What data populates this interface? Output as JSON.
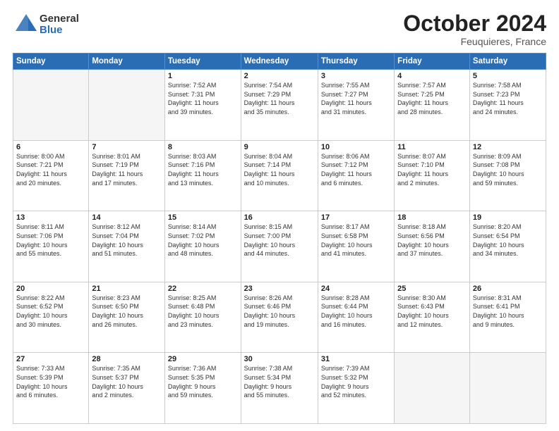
{
  "header": {
    "logo_general": "General",
    "logo_blue": "Blue",
    "month": "October 2024",
    "location": "Feuquieres, France"
  },
  "weekdays": [
    "Sunday",
    "Monday",
    "Tuesday",
    "Wednesday",
    "Thursday",
    "Friday",
    "Saturday"
  ],
  "weeks": [
    [
      {
        "day": "",
        "detail": ""
      },
      {
        "day": "",
        "detail": ""
      },
      {
        "day": "1",
        "detail": "Sunrise: 7:52 AM\nSunset: 7:31 PM\nDaylight: 11 hours\nand 39 minutes."
      },
      {
        "day": "2",
        "detail": "Sunrise: 7:54 AM\nSunset: 7:29 PM\nDaylight: 11 hours\nand 35 minutes."
      },
      {
        "day": "3",
        "detail": "Sunrise: 7:55 AM\nSunset: 7:27 PM\nDaylight: 11 hours\nand 31 minutes."
      },
      {
        "day": "4",
        "detail": "Sunrise: 7:57 AM\nSunset: 7:25 PM\nDaylight: 11 hours\nand 28 minutes."
      },
      {
        "day": "5",
        "detail": "Sunrise: 7:58 AM\nSunset: 7:23 PM\nDaylight: 11 hours\nand 24 minutes."
      }
    ],
    [
      {
        "day": "6",
        "detail": "Sunrise: 8:00 AM\nSunset: 7:21 PM\nDaylight: 11 hours\nand 20 minutes."
      },
      {
        "day": "7",
        "detail": "Sunrise: 8:01 AM\nSunset: 7:19 PM\nDaylight: 11 hours\nand 17 minutes."
      },
      {
        "day": "8",
        "detail": "Sunrise: 8:03 AM\nSunset: 7:16 PM\nDaylight: 11 hours\nand 13 minutes."
      },
      {
        "day": "9",
        "detail": "Sunrise: 8:04 AM\nSunset: 7:14 PM\nDaylight: 11 hours\nand 10 minutes."
      },
      {
        "day": "10",
        "detail": "Sunrise: 8:06 AM\nSunset: 7:12 PM\nDaylight: 11 hours\nand 6 minutes."
      },
      {
        "day": "11",
        "detail": "Sunrise: 8:07 AM\nSunset: 7:10 PM\nDaylight: 11 hours\nand 2 minutes."
      },
      {
        "day": "12",
        "detail": "Sunrise: 8:09 AM\nSunset: 7:08 PM\nDaylight: 10 hours\nand 59 minutes."
      }
    ],
    [
      {
        "day": "13",
        "detail": "Sunrise: 8:11 AM\nSunset: 7:06 PM\nDaylight: 10 hours\nand 55 minutes."
      },
      {
        "day": "14",
        "detail": "Sunrise: 8:12 AM\nSunset: 7:04 PM\nDaylight: 10 hours\nand 51 minutes."
      },
      {
        "day": "15",
        "detail": "Sunrise: 8:14 AM\nSunset: 7:02 PM\nDaylight: 10 hours\nand 48 minutes."
      },
      {
        "day": "16",
        "detail": "Sunrise: 8:15 AM\nSunset: 7:00 PM\nDaylight: 10 hours\nand 44 minutes."
      },
      {
        "day": "17",
        "detail": "Sunrise: 8:17 AM\nSunset: 6:58 PM\nDaylight: 10 hours\nand 41 minutes."
      },
      {
        "day": "18",
        "detail": "Sunrise: 8:18 AM\nSunset: 6:56 PM\nDaylight: 10 hours\nand 37 minutes."
      },
      {
        "day": "19",
        "detail": "Sunrise: 8:20 AM\nSunset: 6:54 PM\nDaylight: 10 hours\nand 34 minutes."
      }
    ],
    [
      {
        "day": "20",
        "detail": "Sunrise: 8:22 AM\nSunset: 6:52 PM\nDaylight: 10 hours\nand 30 minutes."
      },
      {
        "day": "21",
        "detail": "Sunrise: 8:23 AM\nSunset: 6:50 PM\nDaylight: 10 hours\nand 26 minutes."
      },
      {
        "day": "22",
        "detail": "Sunrise: 8:25 AM\nSunset: 6:48 PM\nDaylight: 10 hours\nand 23 minutes."
      },
      {
        "day": "23",
        "detail": "Sunrise: 8:26 AM\nSunset: 6:46 PM\nDaylight: 10 hours\nand 19 minutes."
      },
      {
        "day": "24",
        "detail": "Sunrise: 8:28 AM\nSunset: 6:44 PM\nDaylight: 10 hours\nand 16 minutes."
      },
      {
        "day": "25",
        "detail": "Sunrise: 8:30 AM\nSunset: 6:43 PM\nDaylight: 10 hours\nand 12 minutes."
      },
      {
        "day": "26",
        "detail": "Sunrise: 8:31 AM\nSunset: 6:41 PM\nDaylight: 10 hours\nand 9 minutes."
      }
    ],
    [
      {
        "day": "27",
        "detail": "Sunrise: 7:33 AM\nSunset: 5:39 PM\nDaylight: 10 hours\nand 6 minutes."
      },
      {
        "day": "28",
        "detail": "Sunrise: 7:35 AM\nSunset: 5:37 PM\nDaylight: 10 hours\nand 2 minutes."
      },
      {
        "day": "29",
        "detail": "Sunrise: 7:36 AM\nSunset: 5:35 PM\nDaylight: 9 hours\nand 59 minutes."
      },
      {
        "day": "30",
        "detail": "Sunrise: 7:38 AM\nSunset: 5:34 PM\nDaylight: 9 hours\nand 55 minutes."
      },
      {
        "day": "31",
        "detail": "Sunrise: 7:39 AM\nSunset: 5:32 PM\nDaylight: 9 hours\nand 52 minutes."
      },
      {
        "day": "",
        "detail": ""
      },
      {
        "day": "",
        "detail": ""
      }
    ]
  ]
}
